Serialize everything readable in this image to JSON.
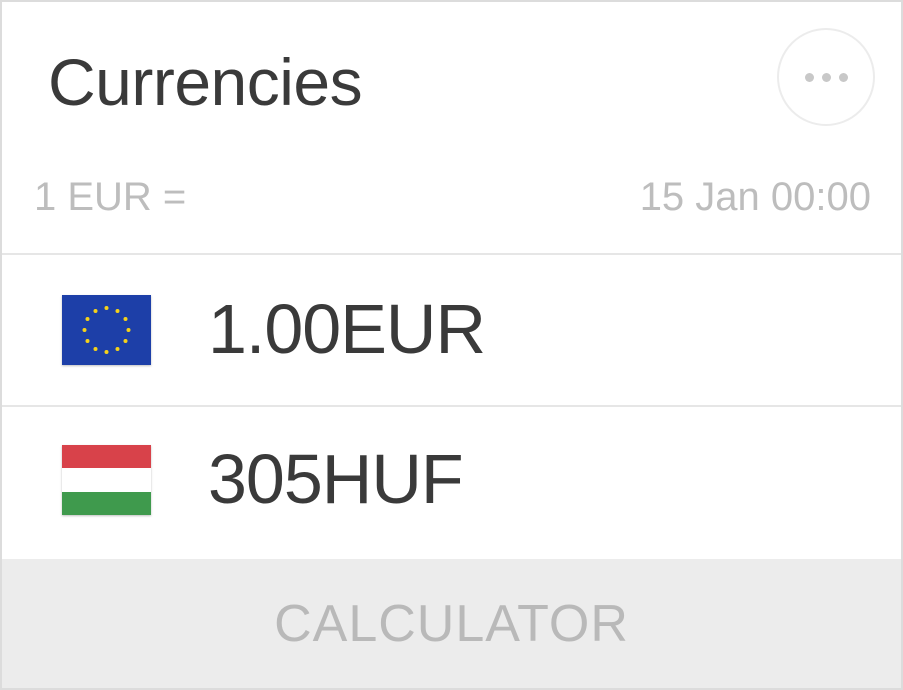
{
  "widget": {
    "title": "Currencies",
    "more_button_icon": "ellipsis-icon",
    "base_label": "1 EUR =",
    "timestamp": "15 Jan 00:00"
  },
  "rows": [
    {
      "flag_icon": "eu-flag-icon",
      "amount": "1.00EUR"
    },
    {
      "flag_icon": "hungary-flag-icon",
      "amount": "305HUF"
    }
  ],
  "footer": {
    "calculator_label": "CALCULATOR"
  },
  "colors": {
    "text_primary": "#3a3a3a",
    "text_secondary": "#bdbdbd",
    "footer_bg": "#ececec",
    "eu_blue": "#1d3fa8",
    "eu_star": "#f5d21a",
    "hu_red": "#d8424a",
    "hu_white": "#ffffff",
    "hu_green": "#3f9a4d"
  }
}
